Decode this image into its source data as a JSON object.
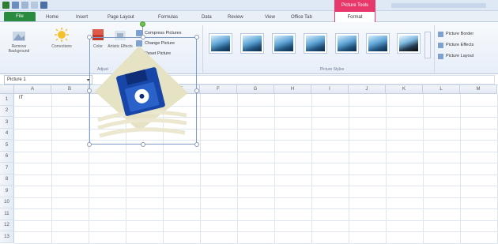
{
  "window": {
    "context_tab": "Picture Tools"
  },
  "tabs": [
    "File",
    "Home",
    "Insert",
    "Page Layout",
    "Formulas",
    "Data",
    "Review",
    "View",
    "Office Tab",
    "Format"
  ],
  "ribbon": {
    "adjust": {
      "remove_background": "Remove Background",
      "corrections": "Corrections",
      "color": "Color",
      "artistic_effects": "Artistic Effects",
      "compress": "Compress Pictures",
      "change": "Change Picture",
      "reset": "Reset Picture",
      "group_label": "Adjust"
    },
    "picture_styles": {
      "group_label": "Picture Styles"
    },
    "right": {
      "border": "Picture Border",
      "effects": "Picture Effects",
      "layout": "Picture Layout"
    }
  },
  "formula_bar": {
    "name_box": "Picture 1",
    "fx": "fx"
  },
  "sheet": {
    "columns": [
      "A",
      "B",
      "C",
      "D",
      "E",
      "F",
      "G",
      "H",
      "I",
      "J",
      "K",
      "L",
      "M"
    ],
    "rows": [
      "1",
      "2",
      "3",
      "4",
      "5",
      "6",
      "7",
      "8",
      "9",
      "10",
      "11",
      "12",
      "13"
    ],
    "cell_a1": "IT"
  },
  "colors": {
    "file_tab": "#2a8a3e",
    "context_tab": "#e8386b",
    "disk": "#1746a8"
  },
  "icons": [
    "remove-background-icon",
    "corrections-icon",
    "color-icon",
    "artistic-effects-icon",
    "floppy-disk-icon"
  ]
}
